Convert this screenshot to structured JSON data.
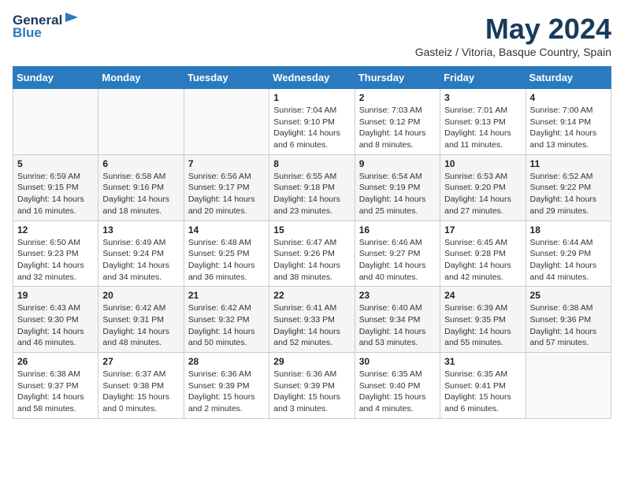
{
  "header": {
    "logo_line1": "General",
    "logo_line2": "Blue",
    "month_title": "May 2024",
    "location": "Gasteiz / Vitoria, Basque Country, Spain"
  },
  "weekdays": [
    "Sunday",
    "Monday",
    "Tuesday",
    "Wednesday",
    "Thursday",
    "Friday",
    "Saturday"
  ],
  "weeks": [
    [
      {
        "day": "",
        "empty": true
      },
      {
        "day": "",
        "empty": true
      },
      {
        "day": "",
        "empty": true
      },
      {
        "day": "1",
        "sunrise": "7:04 AM",
        "sunset": "9:10 PM",
        "daylight": "14 hours and 6 minutes."
      },
      {
        "day": "2",
        "sunrise": "7:03 AM",
        "sunset": "9:12 PM",
        "daylight": "14 hours and 8 minutes."
      },
      {
        "day": "3",
        "sunrise": "7:01 AM",
        "sunset": "9:13 PM",
        "daylight": "14 hours and 11 minutes."
      },
      {
        "day": "4",
        "sunrise": "7:00 AM",
        "sunset": "9:14 PM",
        "daylight": "14 hours and 13 minutes."
      }
    ],
    [
      {
        "day": "5",
        "sunrise": "6:59 AM",
        "sunset": "9:15 PM",
        "daylight": "14 hours and 16 minutes."
      },
      {
        "day": "6",
        "sunrise": "6:58 AM",
        "sunset": "9:16 PM",
        "daylight": "14 hours and 18 minutes."
      },
      {
        "day": "7",
        "sunrise": "6:56 AM",
        "sunset": "9:17 PM",
        "daylight": "14 hours and 20 minutes."
      },
      {
        "day": "8",
        "sunrise": "6:55 AM",
        "sunset": "9:18 PM",
        "daylight": "14 hours and 23 minutes."
      },
      {
        "day": "9",
        "sunrise": "6:54 AM",
        "sunset": "9:19 PM",
        "daylight": "14 hours and 25 minutes."
      },
      {
        "day": "10",
        "sunrise": "6:53 AM",
        "sunset": "9:20 PM",
        "daylight": "14 hours and 27 minutes."
      },
      {
        "day": "11",
        "sunrise": "6:52 AM",
        "sunset": "9:22 PM",
        "daylight": "14 hours and 29 minutes."
      }
    ],
    [
      {
        "day": "12",
        "sunrise": "6:50 AM",
        "sunset": "9:23 PM",
        "daylight": "14 hours and 32 minutes."
      },
      {
        "day": "13",
        "sunrise": "6:49 AM",
        "sunset": "9:24 PM",
        "daylight": "14 hours and 34 minutes."
      },
      {
        "day": "14",
        "sunrise": "6:48 AM",
        "sunset": "9:25 PM",
        "daylight": "14 hours and 36 minutes."
      },
      {
        "day": "15",
        "sunrise": "6:47 AM",
        "sunset": "9:26 PM",
        "daylight": "14 hours and 38 minutes."
      },
      {
        "day": "16",
        "sunrise": "6:46 AM",
        "sunset": "9:27 PM",
        "daylight": "14 hours and 40 minutes."
      },
      {
        "day": "17",
        "sunrise": "6:45 AM",
        "sunset": "9:28 PM",
        "daylight": "14 hours and 42 minutes."
      },
      {
        "day": "18",
        "sunrise": "6:44 AM",
        "sunset": "9:29 PM",
        "daylight": "14 hours and 44 minutes."
      }
    ],
    [
      {
        "day": "19",
        "sunrise": "6:43 AM",
        "sunset": "9:30 PM",
        "daylight": "14 hours and 46 minutes."
      },
      {
        "day": "20",
        "sunrise": "6:42 AM",
        "sunset": "9:31 PM",
        "daylight": "14 hours and 48 minutes."
      },
      {
        "day": "21",
        "sunrise": "6:42 AM",
        "sunset": "9:32 PM",
        "daylight": "14 hours and 50 minutes."
      },
      {
        "day": "22",
        "sunrise": "6:41 AM",
        "sunset": "9:33 PM",
        "daylight": "14 hours and 52 minutes."
      },
      {
        "day": "23",
        "sunrise": "6:40 AM",
        "sunset": "9:34 PM",
        "daylight": "14 hours and 53 minutes."
      },
      {
        "day": "24",
        "sunrise": "6:39 AM",
        "sunset": "9:35 PM",
        "daylight": "14 hours and 55 minutes."
      },
      {
        "day": "25",
        "sunrise": "6:38 AM",
        "sunset": "9:36 PM",
        "daylight": "14 hours and 57 minutes."
      }
    ],
    [
      {
        "day": "26",
        "sunrise": "6:38 AM",
        "sunset": "9:37 PM",
        "daylight": "14 hours and 58 minutes."
      },
      {
        "day": "27",
        "sunrise": "6:37 AM",
        "sunset": "9:38 PM",
        "daylight": "15 hours and 0 minutes."
      },
      {
        "day": "28",
        "sunrise": "6:36 AM",
        "sunset": "9:39 PM",
        "daylight": "15 hours and 2 minutes."
      },
      {
        "day": "29",
        "sunrise": "6:36 AM",
        "sunset": "9:39 PM",
        "daylight": "15 hours and 3 minutes."
      },
      {
        "day": "30",
        "sunrise": "6:35 AM",
        "sunset": "9:40 PM",
        "daylight": "15 hours and 4 minutes."
      },
      {
        "day": "31",
        "sunrise": "6:35 AM",
        "sunset": "9:41 PM",
        "daylight": "15 hours and 6 minutes."
      },
      {
        "day": "",
        "empty": true
      }
    ]
  ]
}
